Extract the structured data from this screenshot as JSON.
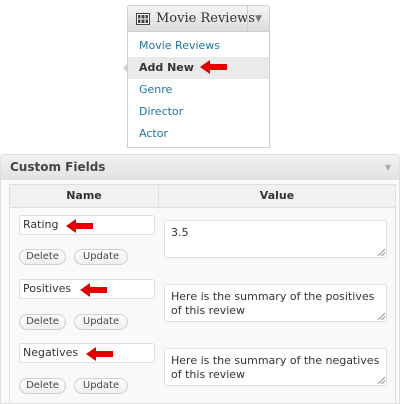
{
  "menu": {
    "title": "Movie Reviews",
    "icon": "grid-icon",
    "items": [
      {
        "label": "Movie Reviews",
        "current": false
      },
      {
        "label": "Add New",
        "current": true
      },
      {
        "label": "Genre",
        "current": false
      },
      {
        "label": "Director",
        "current": false
      },
      {
        "label": "Actor",
        "current": false
      }
    ]
  },
  "custom_fields": {
    "title": "Custom Fields",
    "columns": {
      "name": "Name",
      "value": "Value"
    },
    "rows": [
      {
        "key": "Rating",
        "value": "3.5",
        "delete_label": "Delete",
        "update_label": "Update"
      },
      {
        "key": "Positives",
        "value": "Here is the summary of the positives of this review",
        "delete_label": "Delete",
        "update_label": "Update"
      },
      {
        "key": "Negatives",
        "value": "Here is the summary of the negatives of this review",
        "delete_label": "Delete",
        "update_label": "Update"
      }
    ]
  },
  "colors": {
    "link": "#21759b",
    "annotation_arrow": "#e00000",
    "box_border": "#dfdfdf"
  }
}
